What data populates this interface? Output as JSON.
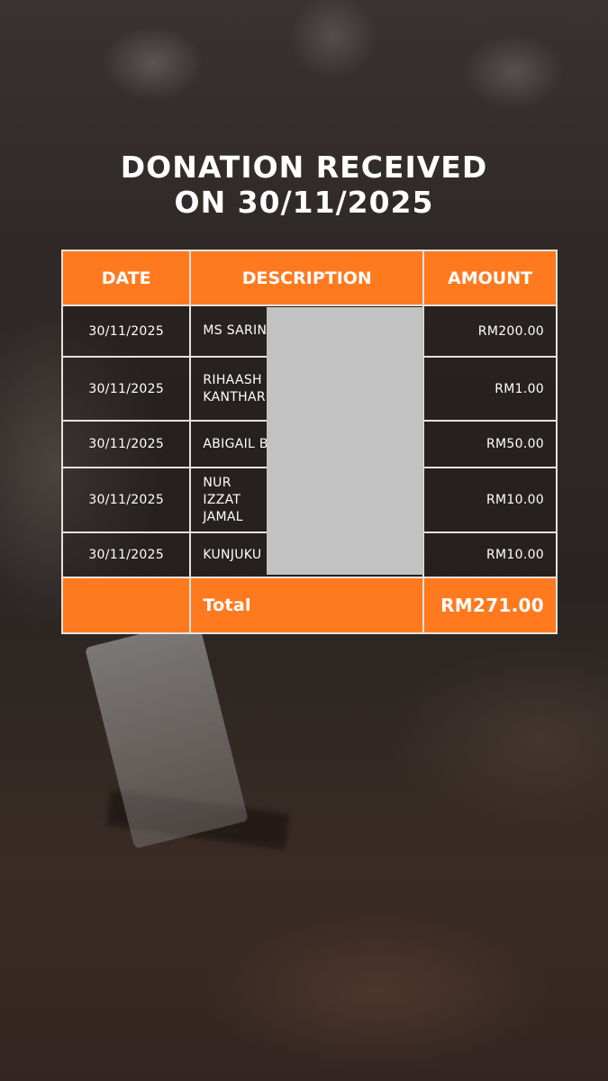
{
  "title": {
    "line1": "DONATION RECEIVED",
    "line2": "ON 30/11/2025"
  },
  "table": {
    "headers": [
      "DATE",
      "DESCRIPTION",
      "AMOUNT"
    ],
    "rows": [
      {
        "date": "30/11/2025",
        "description": "MS SARIN",
        "amount": "RM200.00"
      },
      {
        "date": "30/11/2025",
        "description": "RIHAASH KANTHAR",
        "amount": "RM1.00"
      },
      {
        "date": "30/11/2025",
        "description": "ABIGAIL B",
        "amount": "RM50.00"
      },
      {
        "date": "30/11/2025",
        "description": "NUR IZZAT JAMAL",
        "amount": "RM10.00"
      },
      {
        "date": "30/11/2025",
        "description": "KUNJUKU",
        "amount": "RM10.00"
      }
    ],
    "total": {
      "label": "Total",
      "amount": "RM271.00"
    }
  },
  "colors": {
    "accent": "#ff7a1f",
    "redaction": "#c2c2c2"
  }
}
